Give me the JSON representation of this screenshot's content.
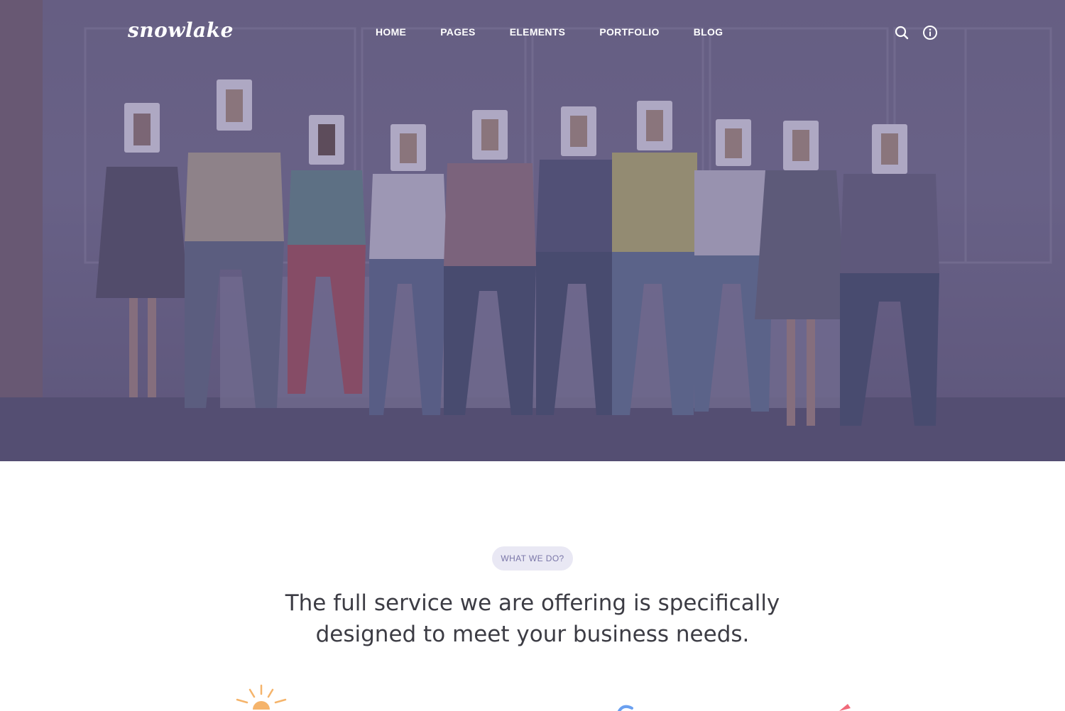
{
  "header": {
    "logo_text": "snowlake",
    "nav": [
      {
        "label": "HOME"
      },
      {
        "label": "PAGES"
      },
      {
        "label": "ELEMENTS"
      },
      {
        "label": "PORTFOLIO"
      },
      {
        "label": "BLOG"
      }
    ],
    "icons": [
      "search-icon",
      "info-icon"
    ]
  },
  "hero": {
    "overlay_color": "#5e5680",
    "people_count": 10
  },
  "section": {
    "badge": "WHAT WE DO?",
    "headline_line1": "The full service we are offering is specifically",
    "headline_line2": "designed to meet your business needs."
  },
  "feature_icons": [
    "sun-icon",
    "chart-icon",
    "pen-icon"
  ],
  "colors": {
    "badge_bg": "#e9e8f4",
    "badge_text": "#7a76a8",
    "headline": "#3c3c44",
    "sun": "#f5b46b",
    "blue": "#6aa0f0",
    "red": "#f06a7a"
  }
}
